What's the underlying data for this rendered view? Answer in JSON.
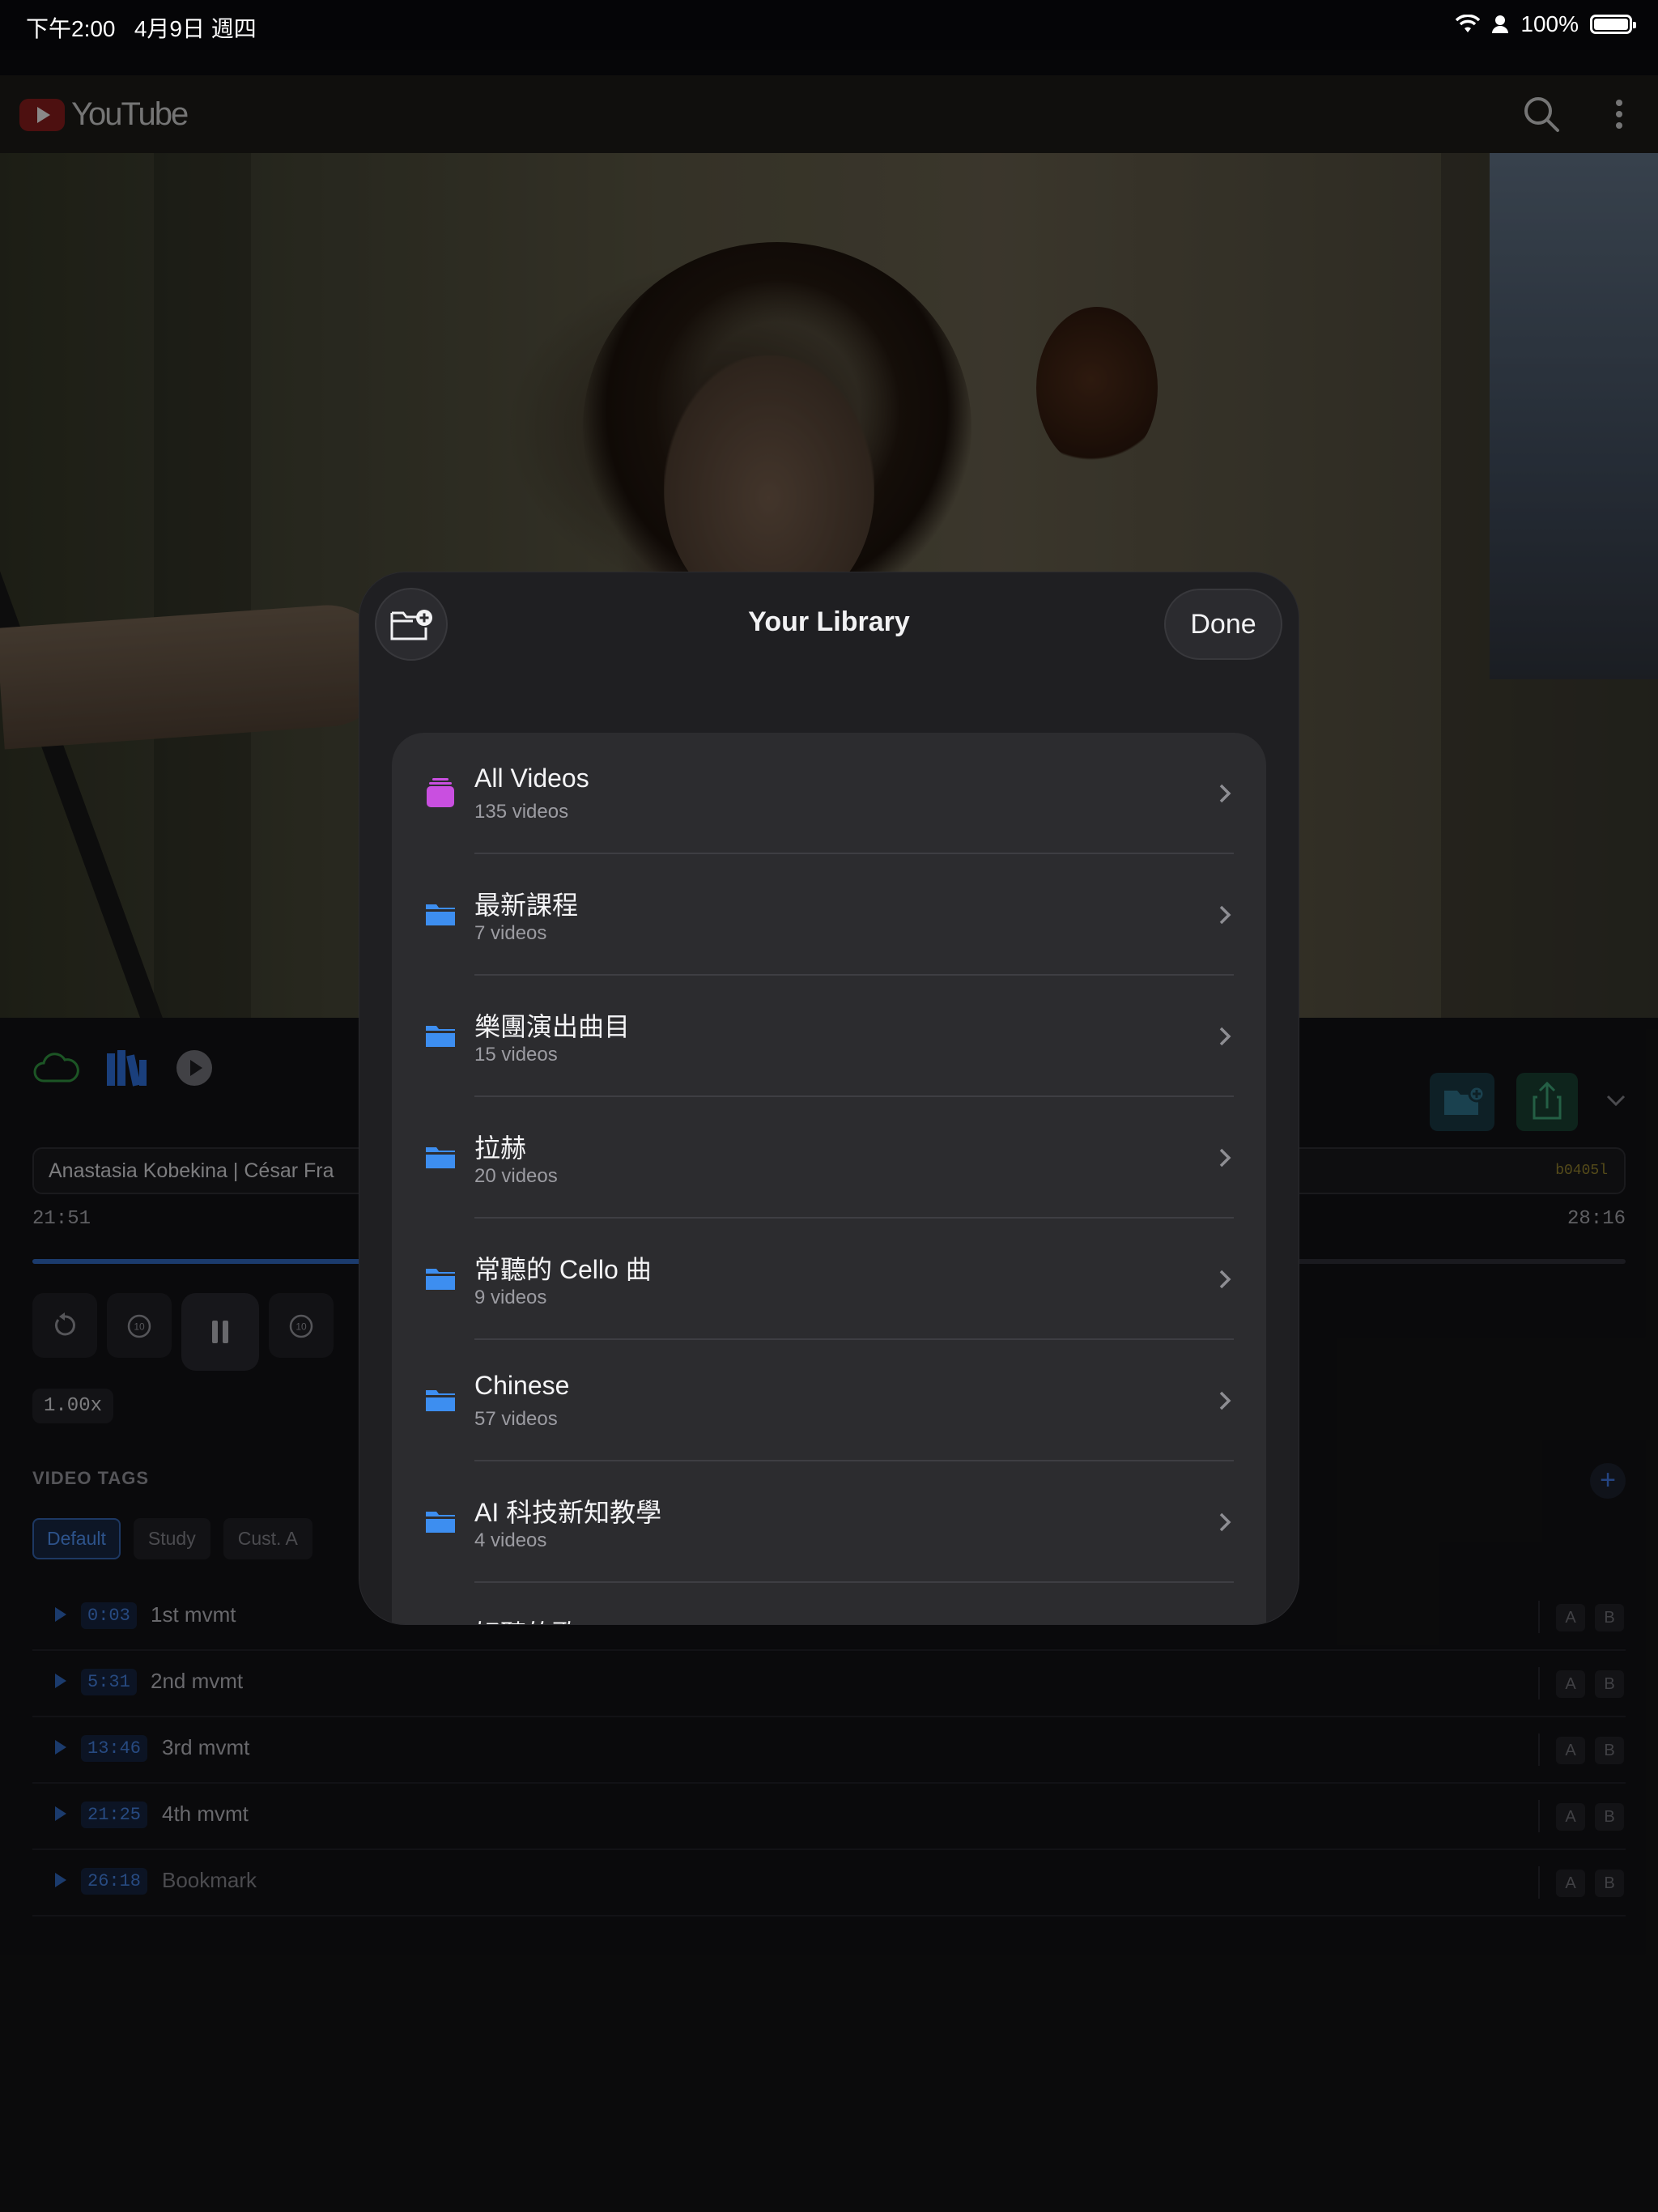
{
  "status_bar": {
    "time": "下午2:00   4月9日 週四",
    "battery": "100%"
  },
  "youtube": {
    "brand": "YouTube"
  },
  "player": {
    "title": "Anastasia Kobekina | César Fra",
    "code": "b0405l",
    "current_time": "21:51",
    "duration": "28:16",
    "progress": 0.773,
    "speed": "1.00x",
    "tags_label": "VIDEO TAGS",
    "tag_add": "+",
    "tags": [
      "Default",
      "Study",
      "Cust. A"
    ],
    "marks": [
      {
        "time": "0:03",
        "label": "1st mvmt",
        "a": "A",
        "b": "B"
      },
      {
        "time": "5:31",
        "label": "2nd mvmt",
        "a": "A",
        "b": "B"
      },
      {
        "time": "13:46",
        "label": "3rd mvmt",
        "a": "A",
        "b": "B"
      },
      {
        "time": "21:25",
        "label": "4th mvmt",
        "a": "A",
        "b": "B"
      },
      {
        "time": "26:18",
        "label": "Bookmark",
        "a": "A",
        "b": "B"
      }
    ]
  },
  "library": {
    "title": "Your Library",
    "done": "Done",
    "items": [
      {
        "title": "All Videos",
        "sub": "135 videos",
        "icon": "stack-icon",
        "color": "#c94fe0"
      },
      {
        "title": "最新課程",
        "sub": "7 videos",
        "icon": "folder-icon",
        "color": "#3d8ef0"
      },
      {
        "title": "樂團演出曲目",
        "sub": "15 videos",
        "icon": "folder-icon",
        "color": "#3d8ef0"
      },
      {
        "title": "拉赫",
        "sub": "20 videos",
        "icon": "folder-icon",
        "color": "#3d8ef0"
      },
      {
        "title": "常聽的 Cello 曲",
        "sub": "9 videos",
        "icon": "folder-icon",
        "color": "#3d8ef0"
      },
      {
        "title": "Chinese",
        "sub": "57 videos",
        "icon": "folder-icon",
        "color": "#3d8ef0"
      },
      {
        "title": "AI 科技新知教學",
        "sub": "4 videos",
        "icon": "folder-icon",
        "color": "#3d8ef0"
      },
      {
        "title": "好聽的歌",
        "sub": "",
        "icon": "folder-icon",
        "color": "#3d8ef0"
      }
    ]
  },
  "colors": {
    "accent": "#3d8ef0",
    "all_videos": "#c94fe0",
    "progress": "#2d5fb0"
  }
}
